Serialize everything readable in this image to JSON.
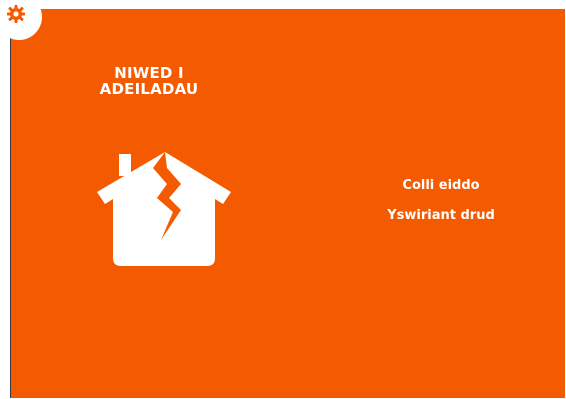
{
  "slide": {
    "background_color": "#f45a00",
    "title_line1": "NIWED I",
    "title_line2": "ADEILADAU",
    "icon": "cracked-house-icon",
    "effects": [
      "Colli eiddo",
      "Yswiriant drud"
    ]
  },
  "corner": {
    "icon": "gear-icon",
    "color": "#f45a00"
  }
}
